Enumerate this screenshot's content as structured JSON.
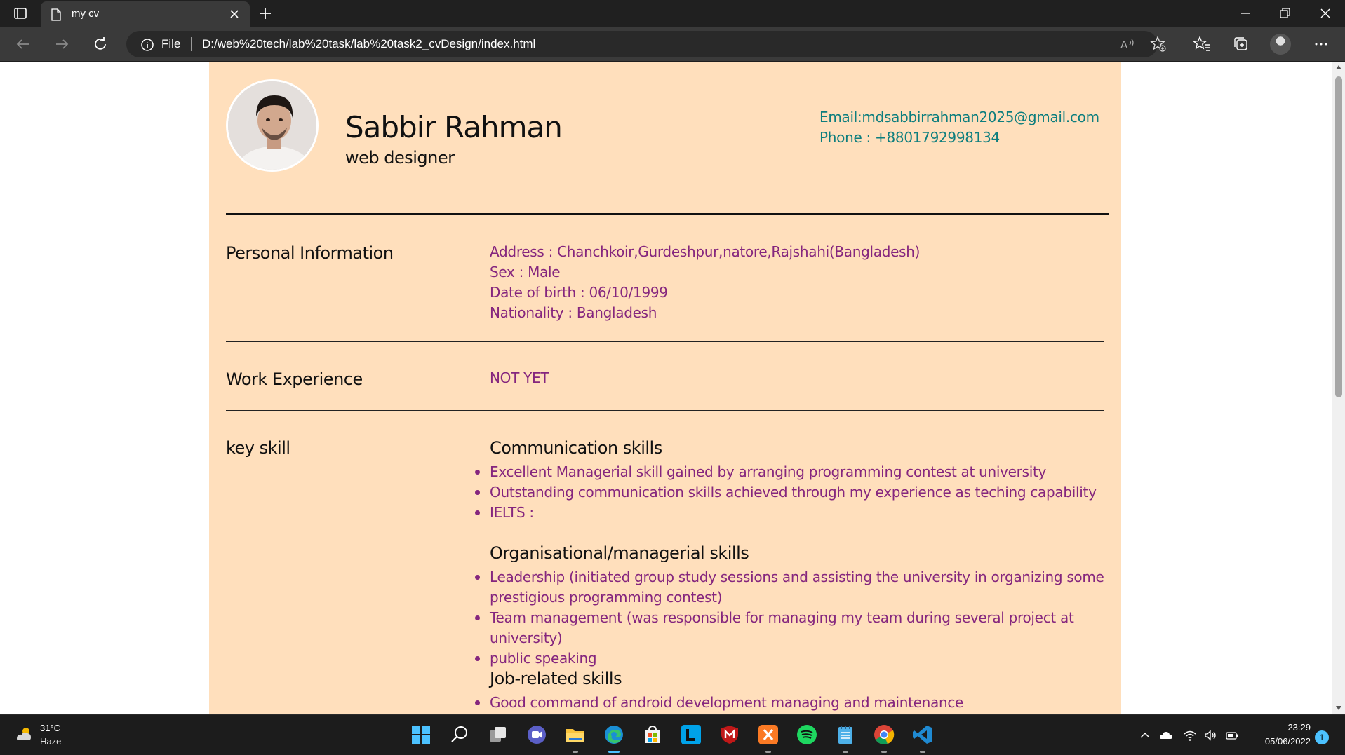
{
  "browser": {
    "tab_title": "my cv",
    "url_scheme_label": "File",
    "url": "D:/web%20tech/lab%20task/lab%20task2_cvDesign/index.html"
  },
  "cv": {
    "name": "Sabbir Rahman",
    "role": "web designer",
    "email": "Email:mdsabbirrahman2025@gmail.com",
    "phone": "Phone : +8801792998134",
    "personal": {
      "title": "Personal Information",
      "lines": [
        "Address : Chanchkoir,Gurdeshpur,natore,Rajshahi(Bangladesh)",
        "Sex : Male",
        "Date of birth : 06/10/1999",
        "Nationality : Bangladesh"
      ]
    },
    "work": {
      "title": "Work Experience",
      "value": "NOT YET"
    },
    "skills": {
      "title": "key skill",
      "groups": [
        {
          "title": "Communication skills",
          "items": [
            "Excellent Managerial skill gained by arranging programming contest at university",
            "Outstanding communication skills achieved through my experience as teching capability",
            "IELTS :"
          ]
        },
        {
          "title": "Organisational/managerial skills",
          "items": [
            "Leadership (initiated group study sessions and assisting the university in organizing some prestigious programming contest)",
            "Team management (was responsible for managing my team during several project at university)",
            "public speaking"
          ]
        },
        {
          "title": "Job-related skills",
          "items": [
            "Good command of android development managing and maintenance"
          ]
        }
      ]
    }
  },
  "taskbar": {
    "weather_temp": "31°C",
    "weather_condition": "Haze",
    "time": "23:29",
    "date": "05/06/2022",
    "notification_count": "1"
  },
  "colors": {
    "cv_background": "#ffdfbc",
    "detail_text": "#85267e",
    "contact_text": "#0d7e7e"
  }
}
